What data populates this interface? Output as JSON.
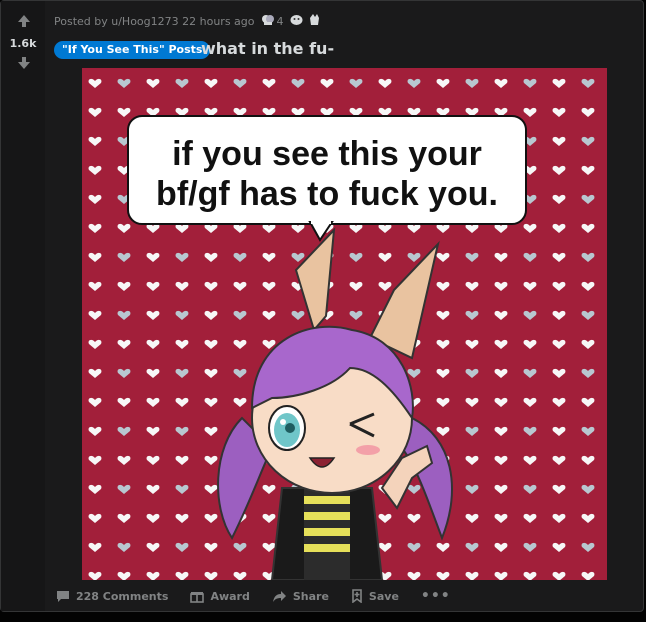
{
  "post": {
    "score": "1.6k",
    "meta": {
      "posted_by": "Posted by u/Hoog1273 22 hours ago",
      "award_count": "4"
    },
    "flair": "\"If You See This\" Posts",
    "title": "what in the fu-",
    "image": {
      "caption_line1": "if you see this your",
      "caption_line2": "bf/gf has to fuck you."
    },
    "actions": {
      "comments": "228 Comments",
      "award": "Award",
      "share": "Share",
      "save": "Save",
      "more": "•••"
    }
  },
  "colors": {
    "page_bg": "#030303",
    "card_bg": "#1a1a1b",
    "text": "#d7dadc",
    "muted": "#818384",
    "flair": "#0079d3",
    "image_bg": "#a21f3a"
  }
}
